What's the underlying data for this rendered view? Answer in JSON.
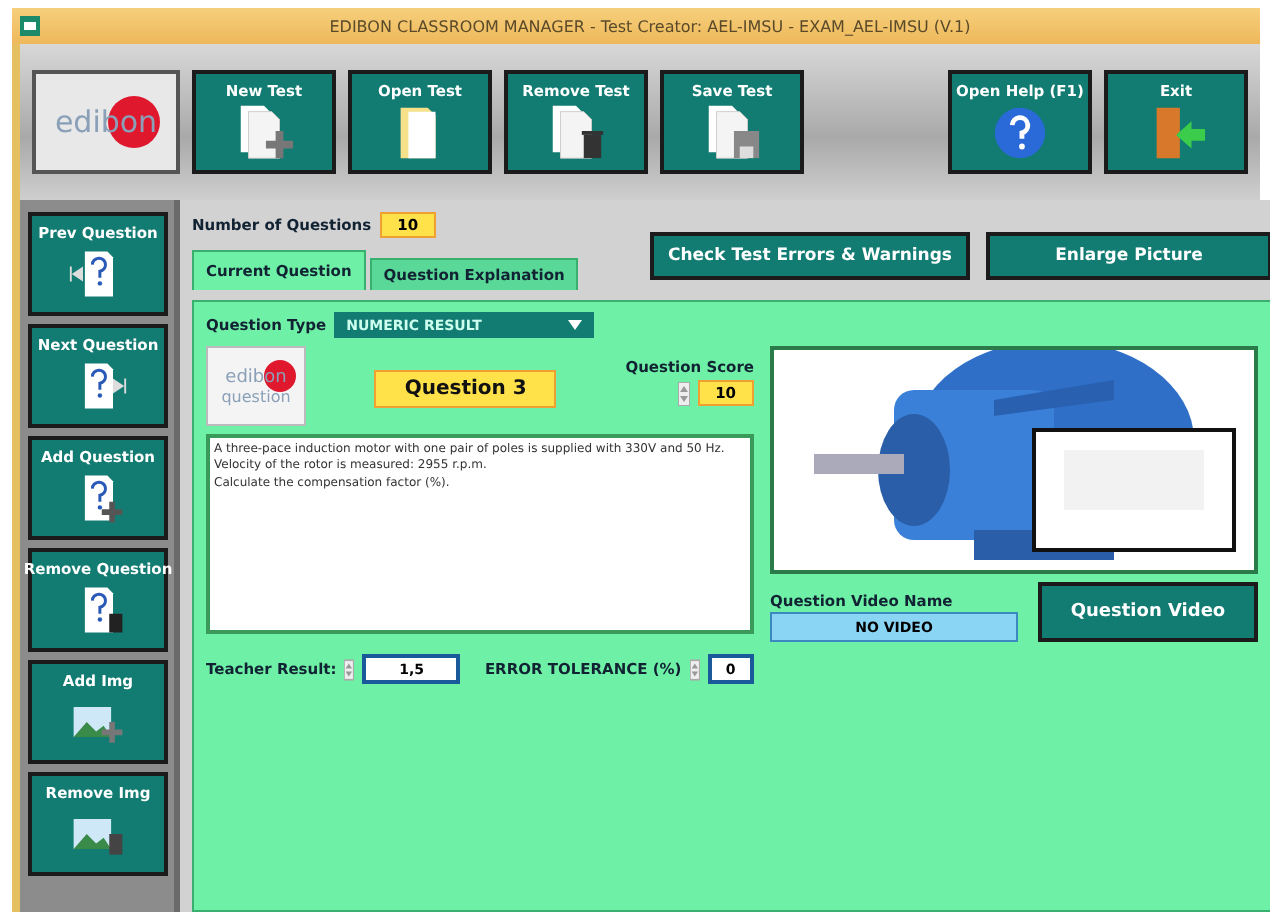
{
  "window": {
    "title": "EDIBON CLASSROOM MANAGER - Test Creator: AEL-IMSU - EXAM_AEL-IMSU (V.1)"
  },
  "logo": {
    "text": "edibon"
  },
  "toolbar": [
    {
      "label": "New Test",
      "kind": "new"
    },
    {
      "label": "Open Test",
      "kind": "open"
    },
    {
      "label": "Remove Test",
      "kind": "remove"
    },
    {
      "label": "Save Test",
      "kind": "save"
    },
    {
      "label": "Open Help (F1)",
      "kind": "help"
    },
    {
      "label": "Exit",
      "kind": "exit"
    }
  ],
  "sidebar": [
    {
      "label": "Prev Question",
      "kind": "prev"
    },
    {
      "label": "Next Question",
      "kind": "next"
    },
    {
      "label": "Add Question",
      "kind": "add"
    },
    {
      "label": "Remove Question",
      "kind": "remove"
    },
    {
      "label": "Add Img",
      "kind": "addimg"
    },
    {
      "label": "Remove Img",
      "kind": "removeimg"
    }
  ],
  "number_of_questions": {
    "label": "Number of Questions",
    "value": "10"
  },
  "actions": [
    "Check Test Errors & Warnings",
    "Enlarge Picture"
  ],
  "tabs": [
    {
      "label": "Current Question",
      "selected": true
    },
    {
      "label": "Question Explanation",
      "selected": false
    }
  ],
  "question_type": {
    "label": "Question Type",
    "value": "NUMERIC RESULT"
  },
  "question_logo": {
    "brand": "edibon",
    "sub": "question"
  },
  "question_title": "Question 3",
  "question_score": {
    "label": "Question Score",
    "value": "10"
  },
  "question_text": [
    "A three-pace induction motor with one pair of poles is supplied with 330V and 50 Hz. Velocity of the rotor is measured: 2955 r.p.m.",
    "Calculate the compensation factor (%)."
  ],
  "teacher_result": {
    "label": "Teacher Result:",
    "value": "1,5"
  },
  "error_tolerance": {
    "label": "ERROR TOLERANCE (%)",
    "value": "0"
  },
  "video": {
    "label": "Question Video Name",
    "value": "NO VIDEO",
    "button": "Question Video"
  }
}
